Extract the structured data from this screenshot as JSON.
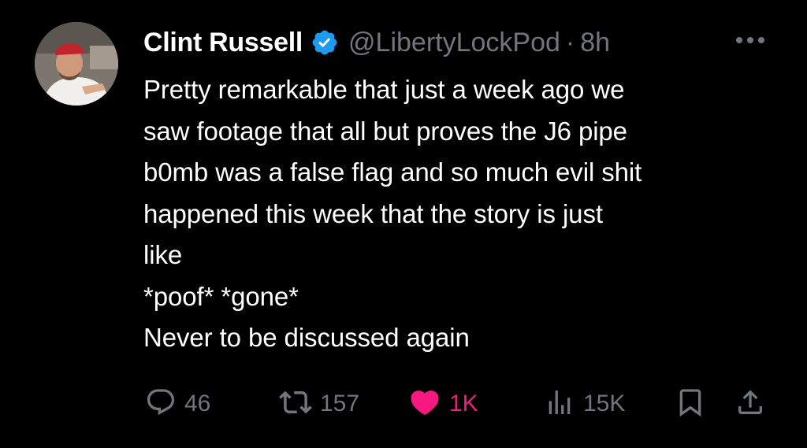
{
  "author": {
    "name": "Clint Russell",
    "handle": "@LibertyLockPod",
    "separator": "·",
    "time": "8h",
    "verified": true
  },
  "tweet": {
    "lines": [
      "Pretty remarkable that just a week ago we",
      "saw footage that all but proves the J6 pipe",
      "b0mb was a false flag and so much evil shit",
      "happened this week that the story is just",
      "like",
      "*poof* *gone*",
      "Never to be discussed again"
    ]
  },
  "actions": {
    "replies": "46",
    "reposts": "157",
    "likes": "1K",
    "views": "15K"
  },
  "colors": {
    "background": "#000000",
    "text": "#ffffff",
    "muted": "#71767b",
    "verified": "#1d9bf0",
    "like": "#f91880"
  },
  "icons": {
    "reply": "reply-icon",
    "repost": "repost-icon",
    "like": "heart-icon",
    "views": "views-icon",
    "bookmark": "bookmark-icon",
    "share": "share-icon",
    "more": "more-icon"
  }
}
